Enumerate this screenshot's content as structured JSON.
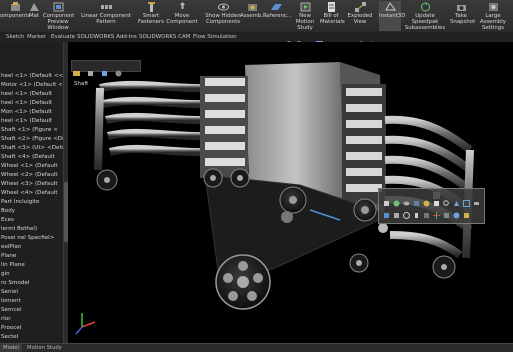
{
  "ribbon": [
    {
      "label": "omponents",
      "icon": "components-icon"
    },
    {
      "label": "Mat",
      "icon": "mate-icon"
    },
    {
      "label": "Component\nPreview Window",
      "icon": "preview-window-icon"
    },
    {
      "label": "Linear Component Pattern",
      "icon": "linear-pattern-icon"
    },
    {
      "label": "Smart\nFasteners",
      "icon": "smart-fasteners-icon"
    },
    {
      "label": "Move Component",
      "icon": "move-component-icon"
    },
    {
      "label": "Show Hidden\nComponents",
      "icon": "show-hidden-icon"
    },
    {
      "label": "Assemb...",
      "icon": "assembly-features-icon"
    },
    {
      "label": "Referenc...",
      "icon": "reference-geometry-icon"
    },
    {
      "label": "New Motion\nStudy",
      "icon": "new-motion-study-icon"
    },
    {
      "label": "Bill of\nMaterials",
      "icon": "bill-of-materials-icon"
    },
    {
      "label": "Exploded View",
      "icon": "exploded-view-icon"
    },
    {
      "label": "Instant3D",
      "icon": "instant3d-icon"
    },
    {
      "label": "Update Speedpak\nSubassemblies",
      "icon": "update-speedpak-icon"
    },
    {
      "label": "Take\nSnapshot",
      "icon": "take-snapshot-icon"
    },
    {
      "label": "Large Assembly\nSettings",
      "icon": "large-assembly-settings-icon"
    }
  ],
  "command_tabs": [
    "Sketch",
    "Marker",
    "Evaluate",
    "SOLIDWORKS Add-Ins",
    "SOLIDWORKS CAM",
    "Flow Simulation"
  ],
  "tree_items": [
    "heel <1> (Default <<",
    "Motor <1> (Default <",
    "heel <1> (Default",
    "heel <1> (Default",
    "Mon <1> (Default",
    "heel <1> (Default",
    "Shaft <1> (Figure <",
    "Shaft <2> (Figure <Dr",
    "Shaft <3> (Ut> <Default",
    "Shaft <4> (Default",
    "Wheel <1> (Default",
    "Wheel <2> (Default",
    "Wheel <3> (Default",
    "Wheel <4> (Default",
    "Part Incluigite",
    "Body",
    "Eces",
    "lerml Bothel)",
    "Posel nel Specfiel>",
    "eelPlan",
    "Plane",
    "lin Plane",
    "gin",
    "ro Smodel",
    "Seniel",
    "Ioment",
    "Semcel",
    "rlor",
    "ProoceI",
    "Sectel",
    "nsell"
  ],
  "bottom_tabs": [
    "Model",
    "Motion Study"
  ],
  "breadcrumb": {
    "label": "Shaft"
  },
  "colors": {
    "accent": "#4a8fd6",
    "ribbon_bg": "#333333",
    "tree_bg": "#1f1f1f"
  }
}
